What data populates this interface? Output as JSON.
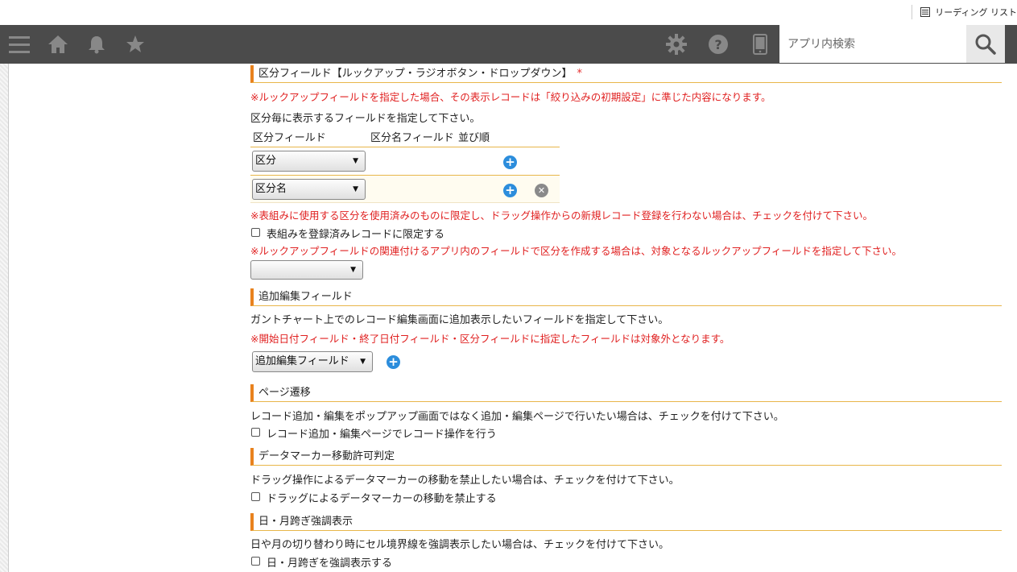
{
  "browser": {
    "reading_list_label": "リーディング リスト"
  },
  "search": {
    "placeholder": "アプリ内検索"
  },
  "lookup_section": {
    "title": "区分フィールド【ルックアップ・ラジオボタン・ドロップダウン】",
    "required_mark": "*",
    "note": "※ルックアップフィールドを指定した場合、その表示レコードは「絞り込みの初期設定」に準じた内容になります。",
    "desc": "区分毎に表示するフィールドを指定して下さい。",
    "col_field": "区分フィールド",
    "col_name_field": "区分名フィールド",
    "col_order": "並び順",
    "rows": [
      {
        "select": "区分"
      },
      {
        "select": "区分名"
      }
    ],
    "restrict_note": "※表組みに使用する区分を使用済みのものに限定し、ドラッグ操作からの新規レコード登録を行わない場合は、チェックを付けて下さい。",
    "restrict_checkbox": "表組みを登録済みレコードに限定する",
    "lookup_note": "※ルックアップフィールドの関連付けるアプリ内のフィールドで区分を作成する場合は、対象となるルックアップフィールドを指定して下さい。",
    "lookup_select": ""
  },
  "edit_section": {
    "title": "追加編集フィールド",
    "desc": "ガントチャート上でのレコード編集画面に追加表示したいフィールドを指定して下さい。",
    "note": "※開始日付フィールド・終了日付フィールド・区分フィールドに指定したフィールドは対象外となります。",
    "select": "追加編集フィールド"
  },
  "page_section": {
    "title": "ページ遷移",
    "desc": "レコード追加・編集をポップアップ画面ではなく追加・編集ページで行いたい場合は、チェックを付けて下さい。",
    "checkbox": "レコード追加・編集ページでレコード操作を行う"
  },
  "marker_section": {
    "title": "データマーカー移動許可判定",
    "desc": "ドラッグ操作によるデータマーカーの移動を禁止したい場合は、チェックを付けて下さい。",
    "checkbox": "ドラッグによるデータマーカーの移動を禁止する"
  },
  "day_section": {
    "title": "日・月跨ぎ強調表示",
    "desc": "日や月の切り替わり時にセル境界線を強調表示したい場合は、チェックを付けて下さい。",
    "checkbox": "日・月跨ぎを強調表示する"
  },
  "colors": {
    "header_bg": "#4b4b4b",
    "accent": "#e8821e",
    "note_red": "#e02020",
    "plus_blue": "#2c8ddc"
  }
}
